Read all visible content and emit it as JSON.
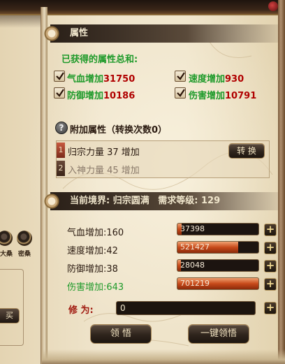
{
  "attributes_header": {
    "title": "属性"
  },
  "summary": {
    "title": "已获得的属性总和:",
    "items": [
      {
        "label": "气血增加",
        "value": "31750"
      },
      {
        "label": "速度增加",
        "value": "930"
      },
      {
        "label": "防御增加",
        "value": "10186"
      },
      {
        "label": "伤害增加",
        "value": "10791"
      }
    ]
  },
  "extra": {
    "help_icon": "?",
    "title": "附加属性（转换次数0）",
    "rows": [
      {
        "tag": "1",
        "text": "归宗力量  37  增加"
      },
      {
        "tag": "2",
        "text": "入神力量  45  增加"
      }
    ],
    "convert_button": "转 换"
  },
  "realm": {
    "text": "当前境界:",
    "realm_name": "归宗圆满",
    "level_text": "需求等级:",
    "level_value": "129"
  },
  "stats": [
    {
      "label": "气血增加:",
      "value": "160",
      "bar_text": "37398",
      "fill": 0.05
    },
    {
      "label": "速度增加:",
      "value": "42",
      "bar_text": "521427",
      "fill": 0.75
    },
    {
      "label": "防御增加:",
      "value": "38",
      "bar_text": "28048",
      "fill": 0.04
    },
    {
      "label": "伤害增加:",
      "value": "643",
      "bar_text": "701219",
      "fill": 1.0
    }
  ],
  "cultivation": {
    "label": "修  为:",
    "value": "0"
  },
  "buttons": {
    "comprehend": "领 悟",
    "one_click": "一键领悟",
    "left_small": "买"
  },
  "side": {
    "orb_a": "大桑",
    "orb_b": "密桑"
  },
  "colors": {
    "green": "#1e9a2a",
    "red": "#b00000",
    "bar_fill": "#c84a1a"
  }
}
